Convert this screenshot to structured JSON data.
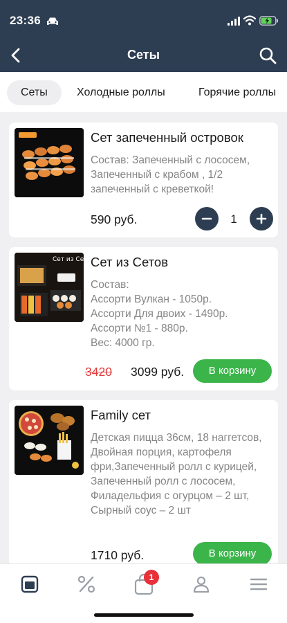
{
  "status_bar": {
    "time": "23:36"
  },
  "header": {
    "title": "Сеты"
  },
  "tabs": [
    {
      "label": "Сеты",
      "active": true
    },
    {
      "label": "Холодные роллы",
      "active": false
    },
    {
      "label": "Горячие  роллы",
      "active": false
    }
  ],
  "products": [
    {
      "name": "Сет запеченный островок",
      "description": "Состав: Запеченный с лососем, Запеченный с крабом , 1/2 запеченный с креветкой!",
      "price": "590 руб.",
      "quantity": "1"
    },
    {
      "name": "Сет из Сетов",
      "description": "Состав:\nАссорти Вулкан - 1050р.\nАссорти Для двоих - 1490р.\nАссорти №1 - 880р.\n Вес: 4000 гр.",
      "old_price": "3420",
      "price": "3099 руб.",
      "button": "В корзину",
      "image_text": "Сет из Сетов"
    },
    {
      "name": "Family сет",
      "description": "Детская пицца 36см, 18 наггетсов, Двойная порция, картофеля фри,Запеченный ролл с курицей, Запеченный ролл с лососем, Филадельфия с огурцом – 2 шт, Сырный соус – 2 шт",
      "price": "1710 руб.",
      "button": "В корзину"
    }
  ],
  "bottom_nav": {
    "items": [
      "menu-icon",
      "discount-icon",
      "cart-icon",
      "profile-icon",
      "hamburger-icon"
    ],
    "cart_badge": "1"
  },
  "colors": {
    "header": "#2e3e52",
    "accent_green": "#3bb54a",
    "old_price_red": "#e23c3c",
    "badge_red": "#e8313a"
  }
}
